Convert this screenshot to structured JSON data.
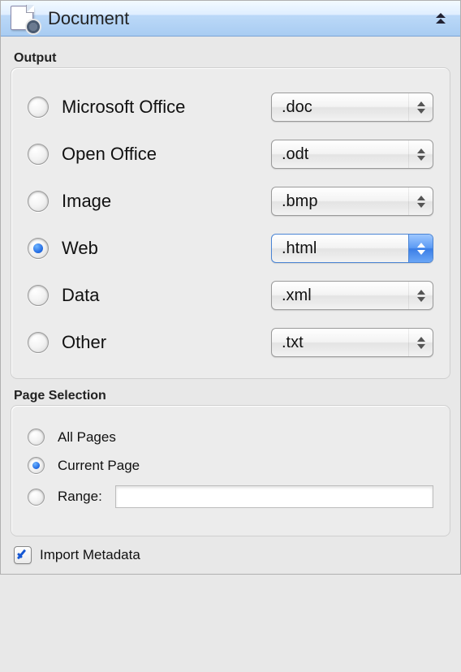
{
  "header": {
    "title": "Document"
  },
  "output": {
    "legend": "Output",
    "formats": [
      {
        "label": "Microsoft Office",
        "ext": ".doc",
        "selected": false
      },
      {
        "label": "Open Office",
        "ext": ".odt",
        "selected": false
      },
      {
        "label": "Image",
        "ext": ".bmp",
        "selected": false
      },
      {
        "label": "Web",
        "ext": ".html",
        "selected": true
      },
      {
        "label": "Data",
        "ext": ".xml",
        "selected": false
      },
      {
        "label": "Other",
        "ext": ".txt",
        "selected": false
      }
    ]
  },
  "pageSelection": {
    "legend": "Page Selection",
    "all": {
      "label": "All Pages",
      "selected": false
    },
    "current": {
      "label": "Current Page",
      "selected": true
    },
    "range": {
      "label": "Range:",
      "selected": false,
      "value": ""
    }
  },
  "importMetadata": {
    "label": "Import Metadata",
    "checked": true
  }
}
